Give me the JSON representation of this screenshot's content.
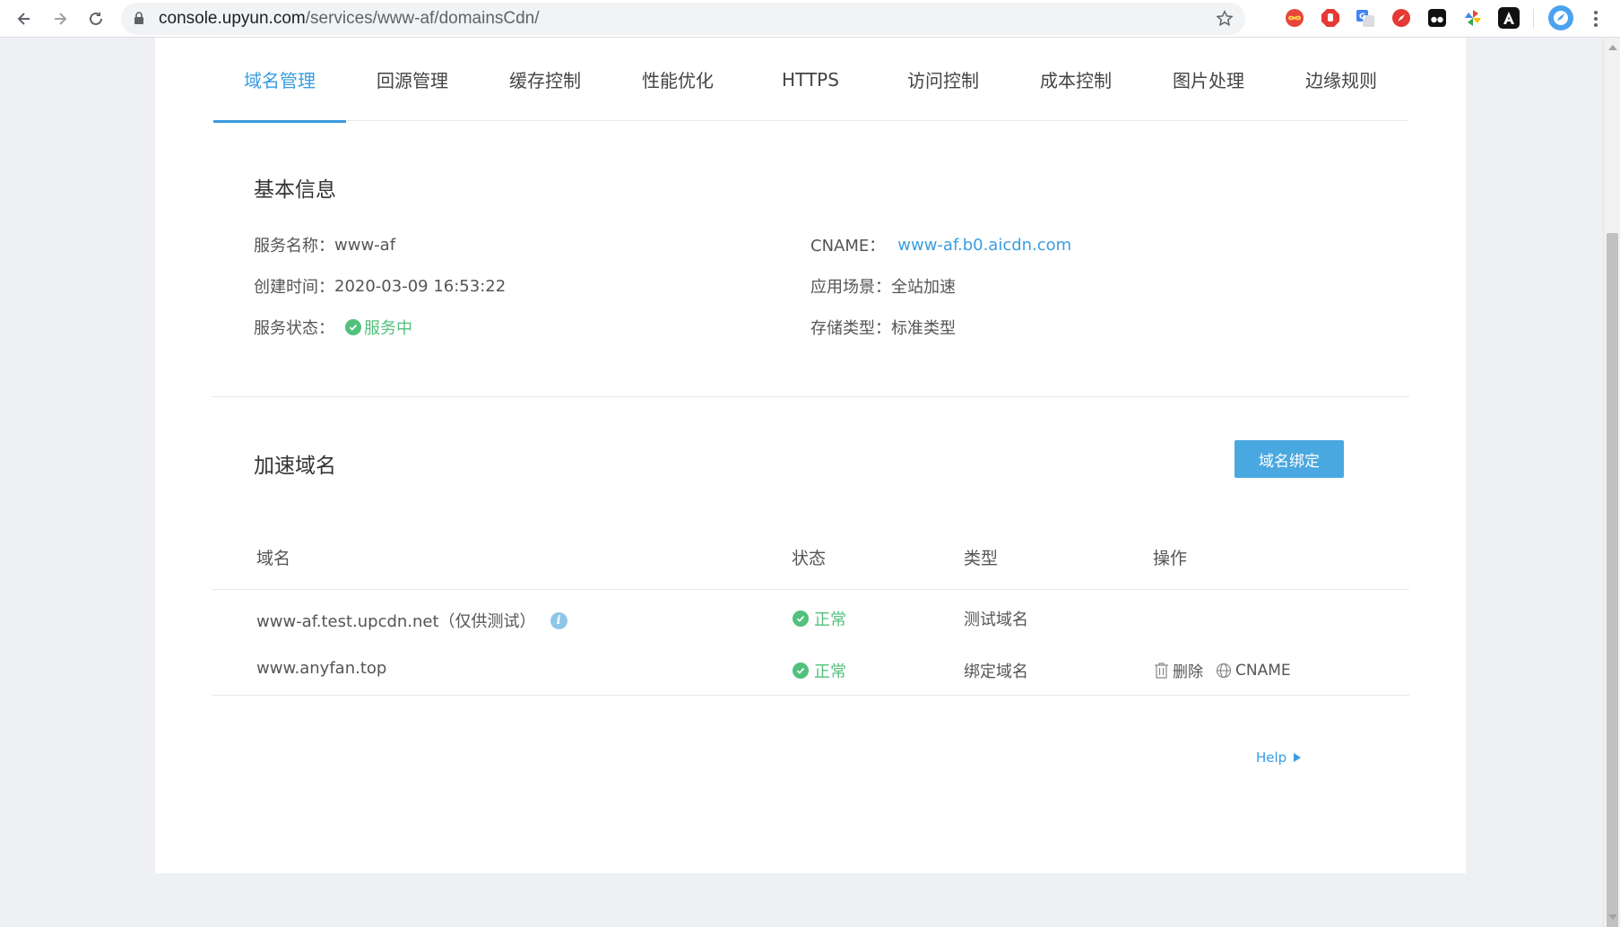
{
  "browser": {
    "url_host": "console.upyun.com",
    "url_path": "/services/www-af/domainsCdn/"
  },
  "tabs": [
    {
      "label": "域名管理",
      "active": true
    },
    {
      "label": "回源管理"
    },
    {
      "label": "缓存控制"
    },
    {
      "label": "性能优化"
    },
    {
      "label": "HTTPS"
    },
    {
      "label": "访问控制"
    },
    {
      "label": "成本控制"
    },
    {
      "label": "图片处理"
    },
    {
      "label": "边缘规则"
    }
  ],
  "basic_info": {
    "title": "基本信息",
    "service_name_label": "服务名称：",
    "service_name": "www-af",
    "created_label": "创建时间：",
    "created": "2020-03-09 16:53:22",
    "status_label": "服务状态：",
    "status": "服务中",
    "cname_label": "CNAME：",
    "cname": "www-af.b0.aicdn.com",
    "scenario_label": "应用场景：",
    "scenario": "全站加速",
    "storage_label": "存储类型：",
    "storage": "标准类型"
  },
  "accel_domains": {
    "title": "加速域名",
    "bind_button": "域名绑定",
    "columns": {
      "domain": "域名",
      "status": "状态",
      "type": "类型",
      "actions": "操作"
    },
    "rows": [
      {
        "domain": "www-af.test.upcdn.net（仅供测试）",
        "status": "正常",
        "type": "测试域名",
        "has_info": true
      },
      {
        "domain": "www.anyfan.top",
        "status": "正常",
        "type": "绑定域名",
        "delete_label": "删除",
        "cname_label": "CNAME"
      }
    ]
  },
  "help": {
    "label": "Help"
  },
  "colors": {
    "accent": "#3a9de0",
    "success": "#52c17c",
    "button": "#4aa8e0"
  }
}
